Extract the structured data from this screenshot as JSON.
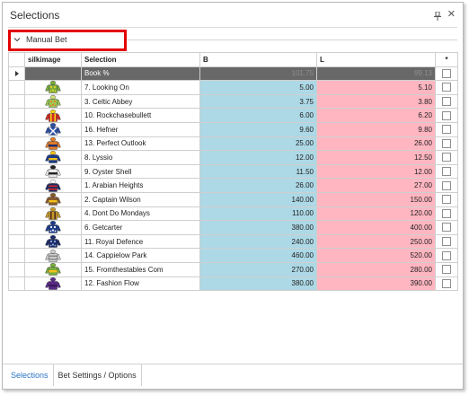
{
  "window": {
    "title": "Selections",
    "pin_icon": "pin-icon",
    "close_glyph": "✕"
  },
  "group": {
    "label": "Manual Bet",
    "icon": "chevron-down-icon"
  },
  "columns": {
    "silk": "silkimage",
    "selection": "Selection",
    "back": "B",
    "lay": "L",
    "check": "*"
  },
  "book_row": {
    "selection": "Book %",
    "back": "101.75",
    "lay": "99.13"
  },
  "rows": [
    {
      "selection": "7. Looking On",
      "back": "5.00",
      "lay": "5.10",
      "silk": {
        "body": "#7aae3a",
        "pattern": "spots",
        "accent": "#e8d12a",
        "cap": "#7aae3a"
      }
    },
    {
      "selection": "3. Celtic Abbey",
      "back": "3.75",
      "lay": "3.80",
      "silk": {
        "body": "#9ccc54",
        "pattern": "spots",
        "accent": "#e07b2a",
        "cap": "#cfe07a"
      }
    },
    {
      "selection": "10. Rockchasebullett",
      "back": "6.00",
      "lay": "6.20",
      "silk": {
        "body": "#d42a1e",
        "pattern": "stripes",
        "accent": "#f2d21a",
        "cap": "#f2d21a"
      }
    },
    {
      "selection": "16. Hefner",
      "back": "9.60",
      "lay": "9.80",
      "silk": {
        "body": "#2a4ea6",
        "pattern": "cross",
        "accent": "#ffffff",
        "cap": "#2a4ea6"
      }
    },
    {
      "selection": "13. Perfect Outlook",
      "back": "25.00",
      "lay": "26.00",
      "silk": {
        "body": "#e07b2a",
        "pattern": "band",
        "accent": "#1a2a6a",
        "cap": "#e07b2a"
      }
    },
    {
      "selection": "8. Lyssio",
      "back": "12.00",
      "lay": "12.50",
      "silk": {
        "body": "#1a3a8a",
        "pattern": "band",
        "accent": "#f2c21a",
        "cap": "#f2c21a"
      }
    },
    {
      "selection": "9. Oyster Shell",
      "back": "11.50",
      "lay": "12.00",
      "silk": {
        "body": "#e8e8e8",
        "pattern": "band",
        "accent": "#222222",
        "cap": "#222222"
      }
    },
    {
      "selection": "1. Arabian Heights",
      "back": "26.00",
      "lay": "27.00",
      "silk": {
        "body": "#1a2a6a",
        "pattern": "hoops",
        "accent": "#d42a1e",
        "cap": "#ffffff"
      }
    },
    {
      "selection": "2. Captain Wilson",
      "back": "140.00",
      "lay": "150.00",
      "silk": {
        "body": "#8a5a2a",
        "pattern": "band",
        "accent": "#f2c21a",
        "cap": "#8a5a2a"
      }
    },
    {
      "selection": "4. Dont Do Mondays",
      "back": "110.00",
      "lay": "120.00",
      "silk": {
        "body": "#c89a2a",
        "pattern": "stripes",
        "accent": "#4a2a1a",
        "cap": "#c89a2a"
      }
    },
    {
      "selection": "6. Getcarter",
      "back": "380.00",
      "lay": "400.00",
      "silk": {
        "body": "#1a3a8a",
        "pattern": "spots",
        "accent": "#ffffff",
        "cap": "#1a3a8a"
      }
    },
    {
      "selection": "11. Royal Defence",
      "back": "240.00",
      "lay": "250.00",
      "silk": {
        "body": "#1a2a6a",
        "pattern": "spots",
        "accent": "#9ab0e0",
        "cap": "#1a2a6a"
      }
    },
    {
      "selection": "14. Cappielow Park",
      "back": "460.00",
      "lay": "520.00",
      "silk": {
        "body": "#cfcfcf",
        "pattern": "hoops",
        "accent": "#8a8a8a",
        "cap": "#cfcfcf"
      }
    },
    {
      "selection": "15. Fromthestables Com",
      "back": "270.00",
      "lay": "280.00",
      "silk": {
        "body": "#7aae3a",
        "pattern": "band",
        "accent": "#f2c21a",
        "cap": "#7aae3a"
      }
    },
    {
      "selection": "12. Fashion Flow",
      "back": "380.00",
      "lay": "390.00",
      "silk": {
        "body": "#5a2a8a",
        "pattern": "band",
        "accent": "#3a1a5a",
        "cap": "#5a2a8a"
      }
    }
  ],
  "tabs": [
    {
      "label": "Selections",
      "active": true
    },
    {
      "label": "Bet Settings / Options",
      "active": false
    }
  ]
}
